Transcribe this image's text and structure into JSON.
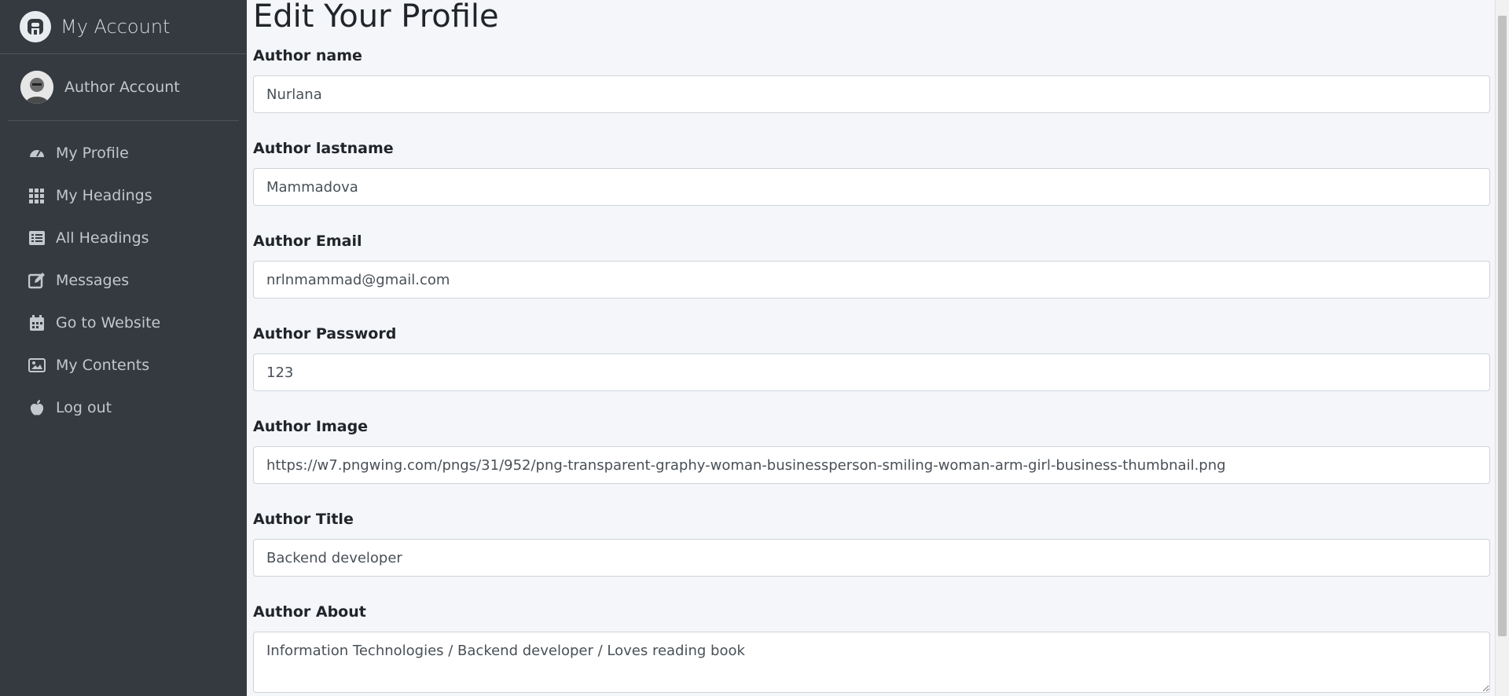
{
  "sidebar": {
    "brand": {
      "title": "My Account",
      "icon": "brand-logo-icon"
    },
    "user": {
      "name": "Author Account"
    },
    "items": [
      {
        "label": "My Profile",
        "icon": "tachometer-icon"
      },
      {
        "label": "My Headings",
        "icon": "grid-icon"
      },
      {
        "label": "All Headings",
        "icon": "list-icon"
      },
      {
        "label": "Messages",
        "icon": "edit-icon"
      },
      {
        "label": "Go to Website",
        "icon": "calendar-icon"
      },
      {
        "label": "My Contents",
        "icon": "image-icon"
      },
      {
        "label": "Log out",
        "icon": "apple-icon"
      }
    ]
  },
  "main": {
    "title": "Edit Your Profile",
    "fields": [
      {
        "label": "Author name",
        "value": "Nurlana"
      },
      {
        "label": "Author lastname",
        "value": "Mammadova"
      },
      {
        "label": "Author Email",
        "value": "nrlnmammad@gmail.com"
      },
      {
        "label": "Author Password",
        "value": "123"
      },
      {
        "label": "Author Image",
        "value": "https://w7.pngwing.com/pngs/31/952/png-transparent-graphy-woman-businessperson-smiling-woman-arm-girl-business-thumbnail.png"
      },
      {
        "label": "Author Title",
        "value": "Backend developer"
      },
      {
        "label": "Author About",
        "value": "Information Technologies / Backend developer / Loves reading book"
      }
    ]
  },
  "colors": {
    "sidebar_bg": "#343a40",
    "main_bg": "#f4f6f9",
    "sidebar_text": "#c2c7d0"
  }
}
